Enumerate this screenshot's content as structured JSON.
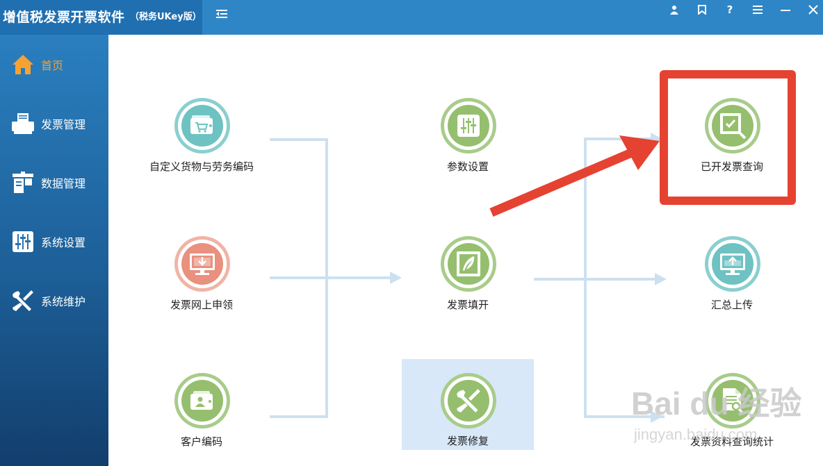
{
  "window": {
    "title": "增值税发票开票软件",
    "edition": "（税务UKey版）"
  },
  "titlebar": {
    "menu_toggle_icon": "collapse-menu-icon",
    "buttons": [
      {
        "icon": "user-icon"
      },
      {
        "icon": "bookmark-icon"
      },
      {
        "icon": "help-icon",
        "label": "?"
      },
      {
        "icon": "menu-icon"
      },
      {
        "icon": "minimize-icon"
      },
      {
        "icon": "close-icon"
      }
    ]
  },
  "sidebar": {
    "items": [
      {
        "label": "首页",
        "icon": "home-icon",
        "active": true
      },
      {
        "label": "发票管理",
        "icon": "printer-icon"
      },
      {
        "label": "数据管理",
        "icon": "data-icon"
      },
      {
        "label": "系统设置",
        "icon": "sliders-icon"
      },
      {
        "label": "系统维护",
        "icon": "tools-icon"
      }
    ]
  },
  "tiles": {
    "custom_goods": {
      "label": "自定义货物与劳务编码",
      "icon": "cart-card-icon"
    },
    "online_apply": {
      "label": "发票网上申领",
      "icon": "monitor-download-icon"
    },
    "customer_code": {
      "label": "客户编码",
      "icon": "wallet-user-icon"
    },
    "params": {
      "label": "参数设置",
      "icon": "sliders-icon"
    },
    "fill_invoice": {
      "label": "发票填开",
      "icon": "feather-film-icon"
    },
    "repair": {
      "label": "发票修复",
      "icon": "tools-icon"
    },
    "query_issued": {
      "label": "已开发票查询",
      "icon": "film-check-search-icon"
    },
    "summary_upload": {
      "label": "汇总上传",
      "icon": "monitor-upload-icon"
    },
    "stats_query": {
      "label": "发票资料查询统计",
      "icon": "document-search-icon"
    }
  },
  "colors": {
    "titlebar": "#2f86c6",
    "sidebar_active": "#f5a233",
    "annotation": "#e64232",
    "connector": "#cde0f0",
    "tile_highlight": "#d8e8f8"
  },
  "watermark": {
    "main": "Bai du 经验",
    "sub": "jingyan.baidu.com"
  }
}
